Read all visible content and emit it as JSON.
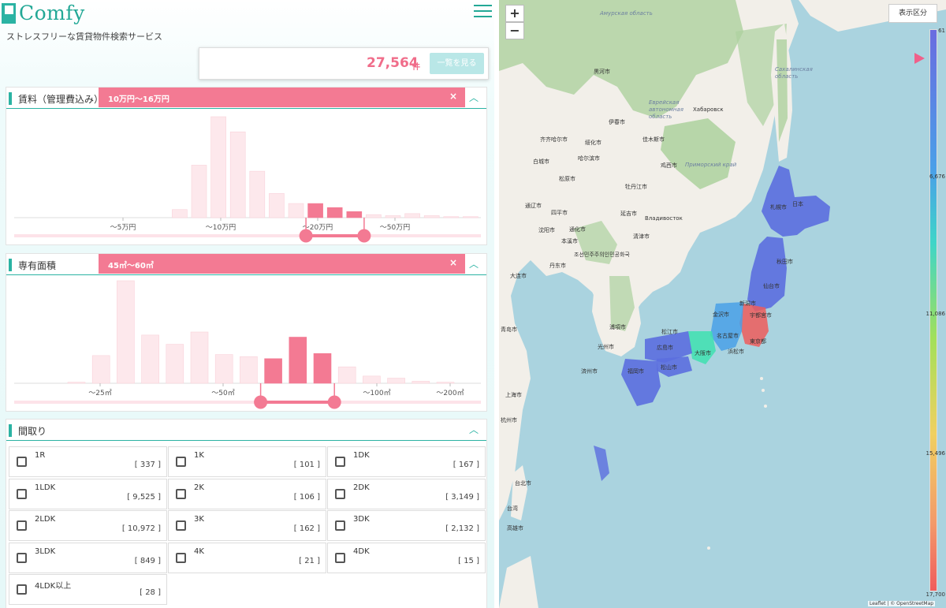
{
  "header": {
    "logo_text": "Comfy",
    "tagline": "ストレスフリーな賃貸物件検索サービス"
  },
  "result": {
    "count": "27,564",
    "unit": "件",
    "list_button": "一覧を見る"
  },
  "rent": {
    "title": "賃料（管理費込み）",
    "filter": "10万円〜16万円",
    "close": "×",
    "collapse": "︿",
    "tick_labels": [
      "〜5万円",
      "〜10万円",
      "〜20万円",
      "〜50万円"
    ],
    "histogram": [
      0,
      0,
      0,
      0,
      8,
      52,
      100,
      85,
      46,
      24,
      14,
      14,
      10,
      6,
      3,
      2,
      4,
      2,
      1,
      1
    ],
    "selected_bins": [
      11,
      12,
      13
    ]
  },
  "area": {
    "title": "専有面積",
    "filter": "45㎡〜60㎡",
    "close": "×",
    "collapse": "︿",
    "tick_labels": [
      "〜25㎡",
      "〜50㎡",
      "〜100㎡",
      "〜200㎡"
    ],
    "histogram": [
      1,
      27,
      100,
      47,
      38,
      50,
      28,
      26,
      24,
      45,
      29,
      16,
      7,
      5,
      2,
      1
    ],
    "selected_bins": [
      8,
      9,
      10
    ]
  },
  "layout": {
    "title": "間取り",
    "collapse": "︿",
    "options": [
      {
        "label": "1R",
        "count": "[ 337 ]"
      },
      {
        "label": "1K",
        "count": "[ 101 ]"
      },
      {
        "label": "1DK",
        "count": "[ 167 ]"
      },
      {
        "label": "1LDK",
        "count": "[ 9,525 ]"
      },
      {
        "label": "2K",
        "count": "[ 106 ]"
      },
      {
        "label": "2DK",
        "count": "[ 3,149 ]"
      },
      {
        "label": "2LDK",
        "count": "[ 10,972 ]"
      },
      {
        "label": "3K",
        "count": "[ 162 ]"
      },
      {
        "label": "3DK",
        "count": "[ 2,132 ]"
      },
      {
        "label": "3LDK",
        "count": "[ 849 ]"
      },
      {
        "label": "4K",
        "count": "[ 21 ]"
      },
      {
        "label": "4DK",
        "count": "[ 15 ]"
      },
      {
        "label": "4LDK以上",
        "count": "[ 28 ]"
      }
    ]
  },
  "map": {
    "zoom_in": "+",
    "zoom_out": "−",
    "display_button": "表示区分",
    "scale_labels": [
      "61",
      "6,676",
      "11,086",
      "15,496",
      "17,700"
    ],
    "attribution": "Leaflet | © OpenStreetMap",
    "colors": {
      "ocean": "#aad3df",
      "land": "#f2efe9",
      "forest": "#add19e"
    },
    "cities": [
      {
        "name": "Хабаровск"
      },
      {
        "name": "Владивосток"
      },
      {
        "name": "黒河市"
      },
      {
        "name": "伊春市"
      },
      {
        "name": "佳木斯市"
      },
      {
        "name": "齐齐哈尔市"
      },
      {
        "name": "绥化市"
      },
      {
        "name": "哈尔滨市"
      },
      {
        "name": "白城市"
      },
      {
        "name": "鸡西市"
      },
      {
        "name": "松原市"
      },
      {
        "name": "牡丹江市"
      },
      {
        "name": "通辽市"
      },
      {
        "name": "四平市"
      },
      {
        "name": "延吉市"
      },
      {
        "name": "沈阳市"
      },
      {
        "name": "通化市"
      },
      {
        "name": "本溪市"
      },
      {
        "name": "清津市"
      },
      {
        "name": "丹东市"
      },
      {
        "name": "大连市"
      },
      {
        "name": "青岛市"
      },
      {
        "name": "浦項市"
      },
      {
        "name": "光州市"
      },
      {
        "name": "済州市"
      },
      {
        "name": "上海市"
      },
      {
        "name": "杭州市"
      },
      {
        "name": "台北市"
      },
      {
        "name": "台湾"
      },
      {
        "name": "高雄市"
      },
      {
        "name": "日本"
      },
      {
        "name": "札幌市"
      },
      {
        "name": "秋田市"
      },
      {
        "name": "仙台市"
      },
      {
        "name": "新潟市"
      },
      {
        "name": "金沢市"
      },
      {
        "name": "宇都宮市"
      },
      {
        "name": "名古屋市"
      },
      {
        "name": "東京都"
      },
      {
        "name": "大阪市"
      },
      {
        "name": "広島市"
      },
      {
        "name": "松江市"
      },
      {
        "name": "福岡市"
      },
      {
        "name": "松山市"
      },
      {
        "name": "浜松市"
      },
      {
        "name": "조선민주주의인민공화국"
      }
    ],
    "regions": [
      {
        "name": "Амурская область"
      },
      {
        "name": "Еврейская автономная область"
      },
      {
        "name": "Сахалинская область"
      },
      {
        "name": "Приморский край"
      }
    ]
  }
}
